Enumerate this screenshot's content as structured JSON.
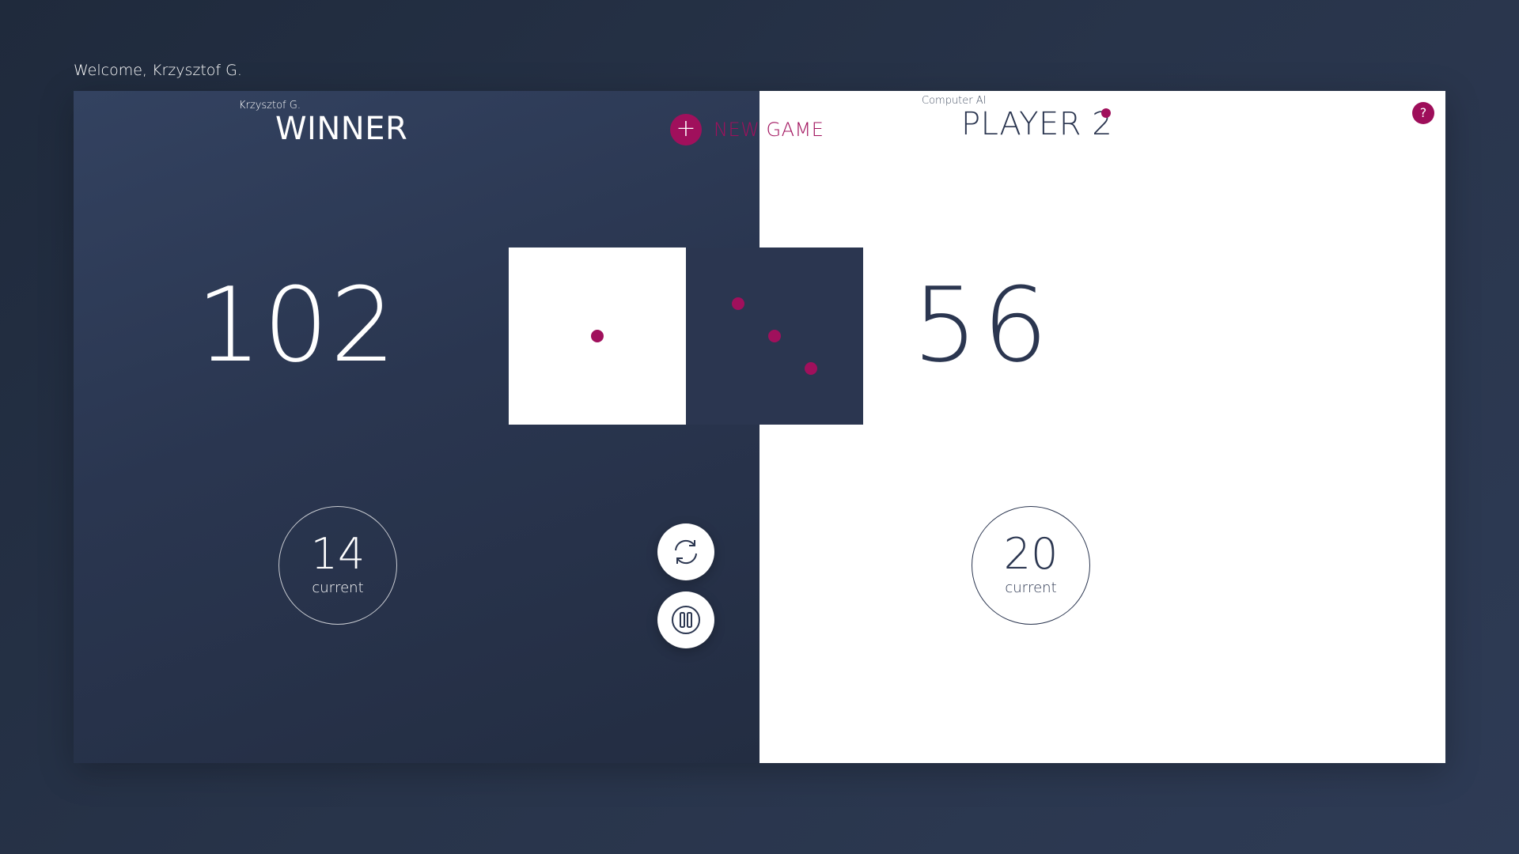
{
  "welcome": "Welcome, Krzysztof G.",
  "player1": {
    "subtitle": "Krzysztof G.",
    "title": "WINNER",
    "score": "102",
    "current_value": "14",
    "current_label": "current"
  },
  "player2": {
    "subtitle": "Computer AI",
    "title": "PLAYER 2",
    "score": "56",
    "current_value": "20",
    "current_label": "current",
    "active": true
  },
  "new_game": {
    "icon": "plus-icon",
    "label": "NEW GAME"
  },
  "help": {
    "icon": "help-icon",
    "label": "?"
  },
  "dice": [
    {
      "value": 1,
      "face": "white"
    },
    {
      "value": 3,
      "face": "dark"
    }
  ],
  "controls": [
    {
      "icon": "refresh-icon",
      "action": "roll"
    },
    {
      "icon": "pause-icon",
      "action": "hold"
    }
  ],
  "colors": {
    "accent": "#a0105c",
    "dark_panel": "#2b3650",
    "light_panel": "#ffffff",
    "background": "#28344a"
  }
}
